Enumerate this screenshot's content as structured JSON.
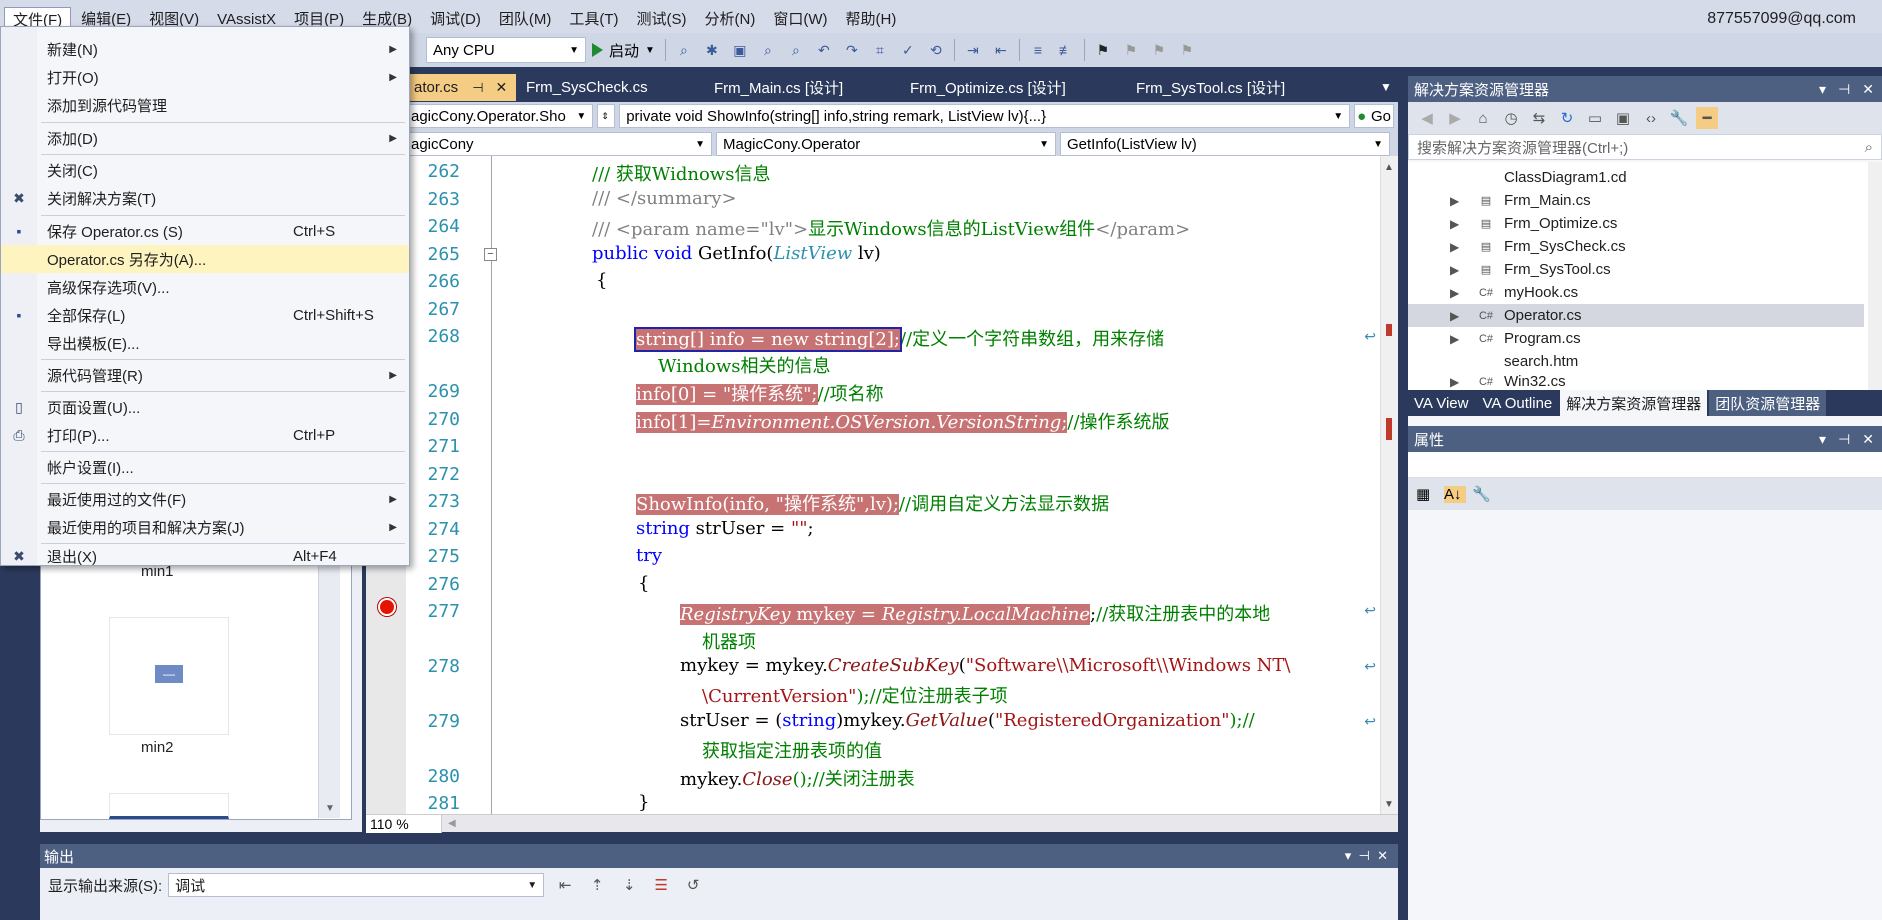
{
  "menubar": {
    "items": [
      "文件(F)",
      "编辑(E)",
      "视图(V)",
      "VAssistX",
      "项目(P)",
      "生成(B)",
      "调试(D)",
      "团队(M)",
      "工具(T)",
      "测试(S)",
      "分析(N)",
      "窗口(W)",
      "帮助(H)"
    ],
    "user": "877557099@qq.com"
  },
  "toolbar": {
    "platform": "Any CPU",
    "start_label": "启动"
  },
  "file_menu": {
    "items": [
      {
        "label": "新建(N)",
        "shortcut": "",
        "submenu": true,
        "icon": ""
      },
      {
        "label": "打开(O)",
        "shortcut": "",
        "submenu": true,
        "icon": ""
      },
      {
        "label": "添加到源代码管理",
        "shortcut": "",
        "submenu": false,
        "icon": ""
      },
      {
        "label": "添加(D)",
        "shortcut": "",
        "submenu": true,
        "icon": ""
      },
      {
        "label": "关闭(C)",
        "shortcut": "",
        "submenu": false,
        "icon": ""
      },
      {
        "label": "关闭解决方案(T)",
        "shortcut": "",
        "submenu": false,
        "icon": "close-solution-icon"
      },
      {
        "label": "保存 Operator.cs (S)",
        "shortcut": "Ctrl+S",
        "submenu": false,
        "icon": "save-icon"
      },
      {
        "label": "Operator.cs 另存为(A)...",
        "shortcut": "",
        "submenu": false,
        "icon": ""
      },
      {
        "label": "高级保存选项(V)...",
        "shortcut": "",
        "submenu": false,
        "icon": ""
      },
      {
        "label": "全部保存(L)",
        "shortcut": "Ctrl+Shift+S",
        "submenu": false,
        "icon": "save-all-icon"
      },
      {
        "label": "导出模板(E)...",
        "shortcut": "",
        "submenu": false,
        "icon": ""
      },
      {
        "label": "源代码管理(R)",
        "shortcut": "",
        "submenu": true,
        "icon": ""
      },
      {
        "label": "页面设置(U)...",
        "shortcut": "",
        "submenu": false,
        "icon": "page-setup-icon"
      },
      {
        "label": "打印(P)...",
        "shortcut": "Ctrl+P",
        "submenu": false,
        "icon": "print-icon"
      },
      {
        "label": "帐户设置(I)...",
        "shortcut": "",
        "submenu": false,
        "icon": ""
      },
      {
        "label": "最近使用过的文件(F)",
        "shortcut": "",
        "submenu": true,
        "icon": ""
      },
      {
        "label": "最近使用的项目和解决方案(J)",
        "shortcut": "",
        "submenu": true,
        "icon": ""
      },
      {
        "label": "退出(X)",
        "shortcut": "Alt+F4",
        "submenu": false,
        "icon": "exit-icon"
      }
    ]
  },
  "editor": {
    "tabs": [
      "ator.cs",
      "Frm_SysCheck.cs",
      "Frm_Main.cs [设计]",
      "Frm_Optimize.cs [设计]",
      "Frm_SysTool.cs [设计]"
    ],
    "nav1_class": "agicCony.Operator.Sho",
    "nav1_method": "private void ShowInfo(string[] info,string remark, ListView lv){...}",
    "nav1_go": "Go",
    "nav2_project": "agicCony",
    "nav2_class": "MagicCony.Operator",
    "nav2_member": "GetInfo(ListView lv)",
    "zoom": "110 %",
    "line_numbers": [
      "262",
      "263",
      "264",
      "265",
      "266",
      "267",
      "268",
      "269",
      "270",
      "271",
      "272",
      "273",
      "274",
      "275",
      "276",
      "277",
      "278",
      "279",
      "280",
      "281"
    ],
    "code": {
      "l262": "/// 获取Widnows信息",
      "l263": "/// </summary>",
      "l264a": "/// <param name=\"lv\">",
      "l264b": "显示Windows信息的ListView组件",
      "l264c": "</param>",
      "l265a": "public void ",
      "l265b": "GetInfo(",
      "l265c": "ListView",
      "l265d": " lv)",
      "l266": "{",
      "l268a": "string[] info = new string[2];",
      "l268b": "//定义一个字符串数组，用来存储",
      "l268c": "Windows相关的信息",
      "l269a": "info[0] = \"操作系统\";",
      "l269b": "//项名称",
      "l270a": "info[1]=",
      "l270b": "Environment.OSVersion.VersionString",
      "l270c": ";",
      "l270d": "//操作系统版",
      "l273a": "ShowInfo(info, \"操作系统\",lv);",
      "l273b": "//调用自定义方法显示数据",
      "l274a": "string",
      "l274b": " strUser = ",
      "l274c": "\"\"",
      "l274d": ";",
      "l275": "try",
      "l276": "{",
      "l277a": "RegistryKey",
      "l277b": " mykey = ",
      "l277c": "Registry.LocalMachine",
      "l277d": ";",
      "l277e": "//获取注册表中的本地",
      "l277f": "机器项",
      "l278a": "mykey = mykey.",
      "l278b": "CreateSubKey",
      "l278c": "(",
      "l278d": "\"Software\\\\Microsoft\\\\Windows NT\\",
      "l278e": "\\CurrentVersion\"",
      "l278f": ");//定位注册表子项",
      "l279a": "strUser = (",
      "l279b": "string",
      "l279c": ")mykey.",
      "l279d": "GetValue",
      "l279e": "(",
      "l279f": "\"RegisteredOrganization\"",
      "l279g": ");//",
      "l279h": "获取指定注册表项的值",
      "l280a": "mykey.",
      "l280b": "Close",
      "l280c": "();//关闭注册表",
      "l281": "}"
    }
  },
  "designer": {
    "labels": [
      "min1",
      "min2"
    ]
  },
  "output": {
    "title": "输出",
    "source_label": "显示输出来源(S):",
    "source_value": "调试"
  },
  "solution_explorer": {
    "title": "解决方案资源管理器",
    "search_placeholder": "搜索解决方案资源管理器(Ctrl+;)",
    "items": [
      {
        "name": "ClassDiagram1.cd",
        "expand": false,
        "icon": "",
        "selected": false
      },
      {
        "name": "Frm_Main.cs",
        "expand": true,
        "icon": "form",
        "selected": false
      },
      {
        "name": "Frm_Optimize.cs",
        "expand": true,
        "icon": "form",
        "selected": false
      },
      {
        "name": "Frm_SysCheck.cs",
        "expand": true,
        "icon": "form",
        "selected": false
      },
      {
        "name": "Frm_SysTool.cs",
        "expand": true,
        "icon": "form",
        "selected": false
      },
      {
        "name": "myHook.cs",
        "expand": true,
        "icon": "c#",
        "selected": false
      },
      {
        "name": "Operator.cs",
        "expand": true,
        "icon": "c#",
        "selected": true
      },
      {
        "name": "Program.cs",
        "expand": true,
        "icon": "c#",
        "selected": false
      },
      {
        "name": "search.htm",
        "expand": false,
        "icon": "",
        "selected": false
      },
      {
        "name": "Win32.cs",
        "expand": true,
        "icon": "c#",
        "selected": false
      }
    ],
    "tabs": [
      "VA View",
      "VA Outline",
      "解决方案资源管理器",
      "团队资源管理器"
    ]
  },
  "properties": {
    "title": "属性"
  },
  "colors": {
    "accent": "#f5cc84",
    "panel_header": "#4d6082",
    "background": "#2b3a5c",
    "highlight": "#c87373"
  }
}
